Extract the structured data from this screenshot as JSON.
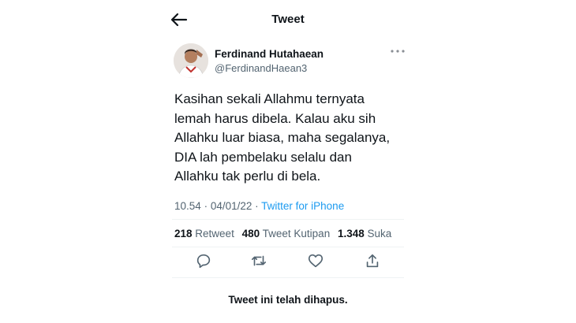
{
  "header": {
    "title": "Tweet",
    "back_icon": "arrow-left-icon"
  },
  "author": {
    "name": "Ferdinand Hutahaean",
    "handle": "@FerdinandHaean3"
  },
  "tweet": {
    "lines": [
      "Kasihan sekali Allahmu ternyata",
      "lemah harus dibela. Kalau aku sih",
      "Allahku luar biasa, maha segalanya,",
      "DIA lah pembelaku selalu dan",
      "Allahku tak perlu di bela."
    ],
    "time": "10.54",
    "date": "04/01/22",
    "source": "Twitter for iPhone"
  },
  "stats": {
    "retweets": "218",
    "retweets_label": "Retweet",
    "quotes": "480",
    "quotes_label": "Tweet Kutipan",
    "likes": "1.348",
    "likes_label": "Suka"
  },
  "actions": [
    "reply-icon",
    "retweet-icon",
    "like-icon",
    "share-icon"
  ],
  "notice": "Tweet ini telah dihapus.",
  "colors": {
    "link": "#1d9bf0",
    "secondary": "#536471",
    "text": "#0f1419"
  }
}
